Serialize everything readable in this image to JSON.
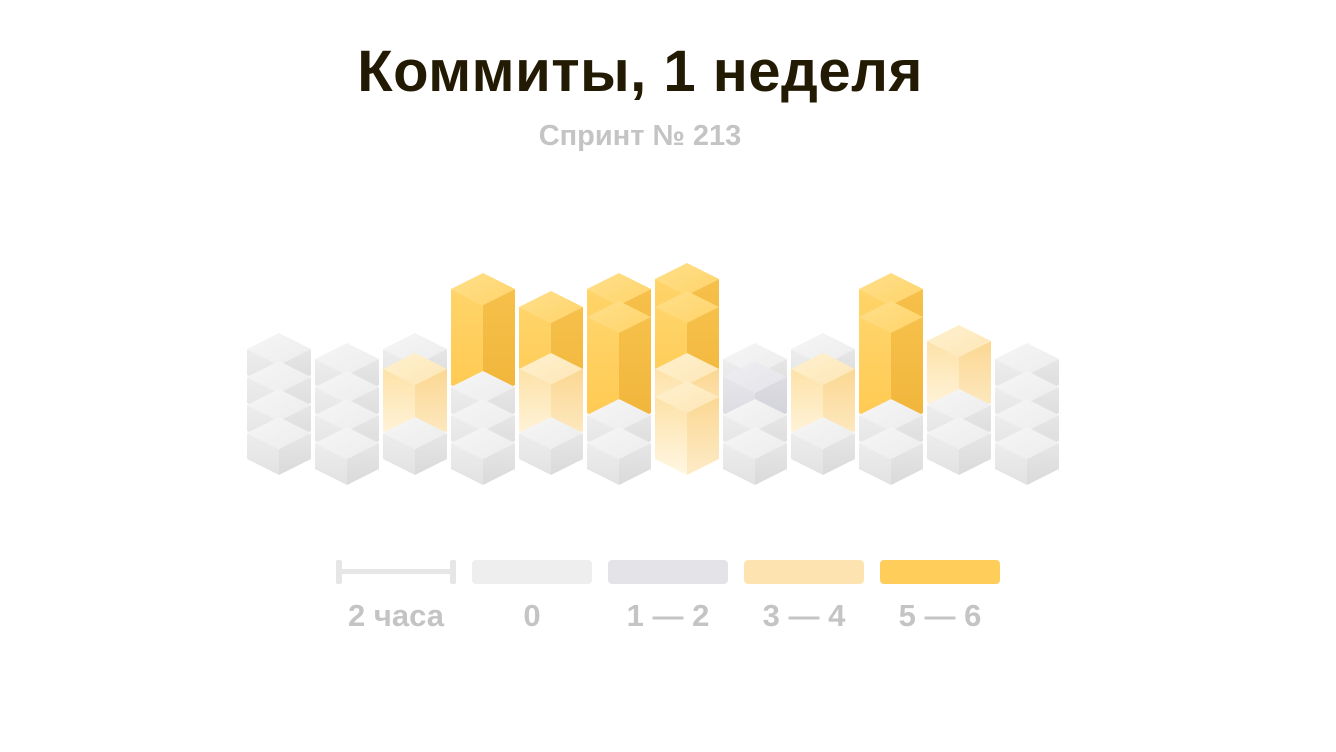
{
  "title": "Коммиты, 1 неделя",
  "subtitle": "Спринт № 213",
  "colors": {
    "level_0": "#eeeeee",
    "level_1": "#e3e3e8",
    "level_2": "#fde3b0",
    "level_3": "#ffcd5a"
  },
  "legend": {
    "scale_label": "2 часа",
    "items": [
      {
        "label": "0",
        "color": "#eeeeee"
      },
      {
        "label": "1 — 2",
        "color": "#e3e3e8"
      },
      {
        "label": "3 — 4",
        "color": "#fde3b0"
      },
      {
        "label": "5 — 6",
        "color": "#ffcd5a"
      }
    ]
  },
  "chart_data": {
    "type": "heatmap",
    "title": "Коммиты, 1 неделя",
    "subtitle": "Спринт № 213",
    "levels": [
      "0",
      "1 — 2",
      "3 — 4",
      "5 — 6"
    ],
    "rows": 4,
    "cols": 12,
    "values": [
      [
        0,
        0,
        0,
        3,
        2,
        3,
        3,
        0,
        0,
        3,
        0,
        0
      ],
      [
        0,
        0,
        0,
        0,
        3,
        3,
        3,
        1,
        0,
        3,
        2,
        0
      ],
      [
        0,
        0,
        2,
        0,
        2,
        0,
        2,
        0,
        2,
        0,
        0,
        0
      ],
      [
        0,
        0,
        0,
        0,
        0,
        0,
        2,
        0,
        0,
        0,
        0,
        0
      ]
    ]
  }
}
